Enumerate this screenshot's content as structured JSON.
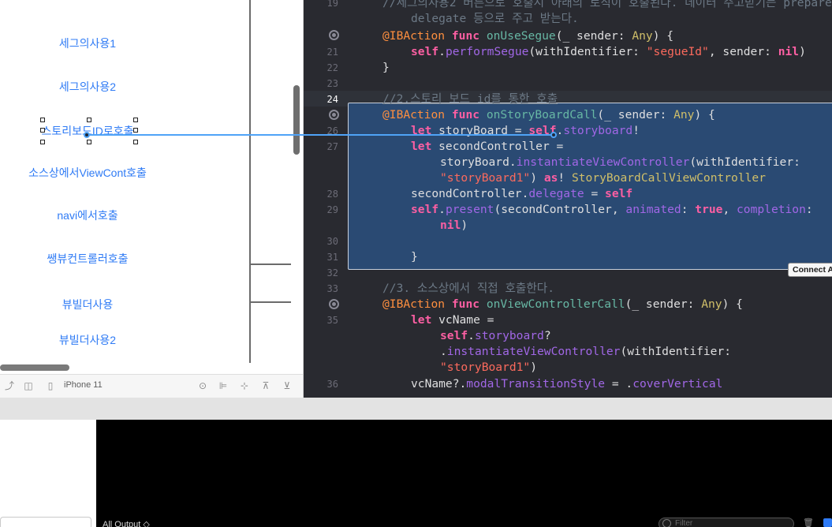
{
  "storyboard": {
    "buttons": [
      {
        "label": "세그의사용1"
      },
      {
        "label": "세그의사용2"
      },
      {
        "label": "스토리보드ID로호출"
      },
      {
        "label": "소스상에서ViewCont호출"
      },
      {
        "label": "navi에서호출"
      },
      {
        "label": "쌩뷰컨트롤러호출"
      },
      {
        "label": "뷰빌더사용"
      },
      {
        "label": "뷰빌더사용2"
      }
    ],
    "device_bar": {
      "device_name": "iPhone 11",
      "icons": [
        "rotate-icon",
        "split-view-icon",
        "device-icon",
        "zoom-fit-icon",
        "align-icon",
        "add-constraints-icon",
        "resolve-issues-icon",
        "embed-in-icon"
      ]
    }
  },
  "editor": {
    "lines": {
      "l19": "19",
      "l21": "21",
      "l22": "22",
      "l23": "23",
      "l24": "24",
      "l26": "26",
      "l27": "27",
      "l28": "28",
      "l29": "29",
      "l30": "30",
      "l31": "31",
      "l32": "32",
      "l33": "33",
      "l35": "35",
      "l36": "36"
    },
    "comment1": "//세그의사용2 버튼으로 호출시 아래의 로직이 호출된다. 데이터 주고받기는 prepare,",
    "comment1b": "delegate 등으로 주고 받는다.",
    "comment2": "//2.스토리 보드 id를 통한 호출",
    "comment3": "//3. 소스상에서 직접 호출한다.",
    "connect_tooltip": "Connect A"
  },
  "debug": {
    "output_selector": "All Output ◇",
    "filter_placeholder": "Filter"
  },
  "colors": {
    "editor_bg": "#292a30",
    "selection": "#2a4a73",
    "keyword": "#fc5fa3",
    "string": "#fc6a5d",
    "link_blue": "#2f7bf5"
  }
}
